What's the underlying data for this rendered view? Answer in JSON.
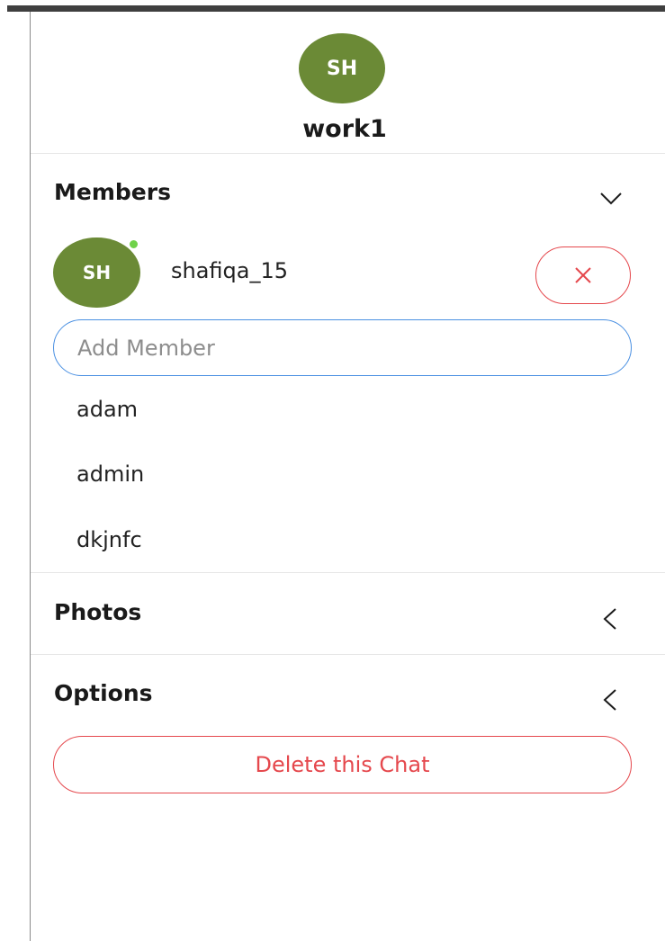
{
  "chat": {
    "avatar_initials": "SH",
    "name": "work1",
    "avatar_color": "#6b8a36"
  },
  "sections": {
    "members": {
      "title": "Members",
      "chevron_icon": "chevron-down-icon"
    },
    "photos": {
      "title": "Photos",
      "chevron_icon": "chevron-left-icon"
    },
    "options": {
      "title": "Options",
      "chevron_icon": "chevron-left-icon"
    }
  },
  "members": [
    {
      "initials": "SH",
      "username": "shafiqa_15",
      "online": true,
      "remove_icon": "close-icon"
    }
  ],
  "add_member": {
    "placeholder": "Add Member",
    "value": ""
  },
  "suggestions": [
    "adam",
    "admin",
    "dkjnfc"
  ],
  "options": {
    "delete_label": "Delete this Chat"
  },
  "colors": {
    "accent_blue": "#4a90e2",
    "danger_red": "#e5484d",
    "online_green": "#6fd24a",
    "top_bar": "#3f3f3f"
  }
}
